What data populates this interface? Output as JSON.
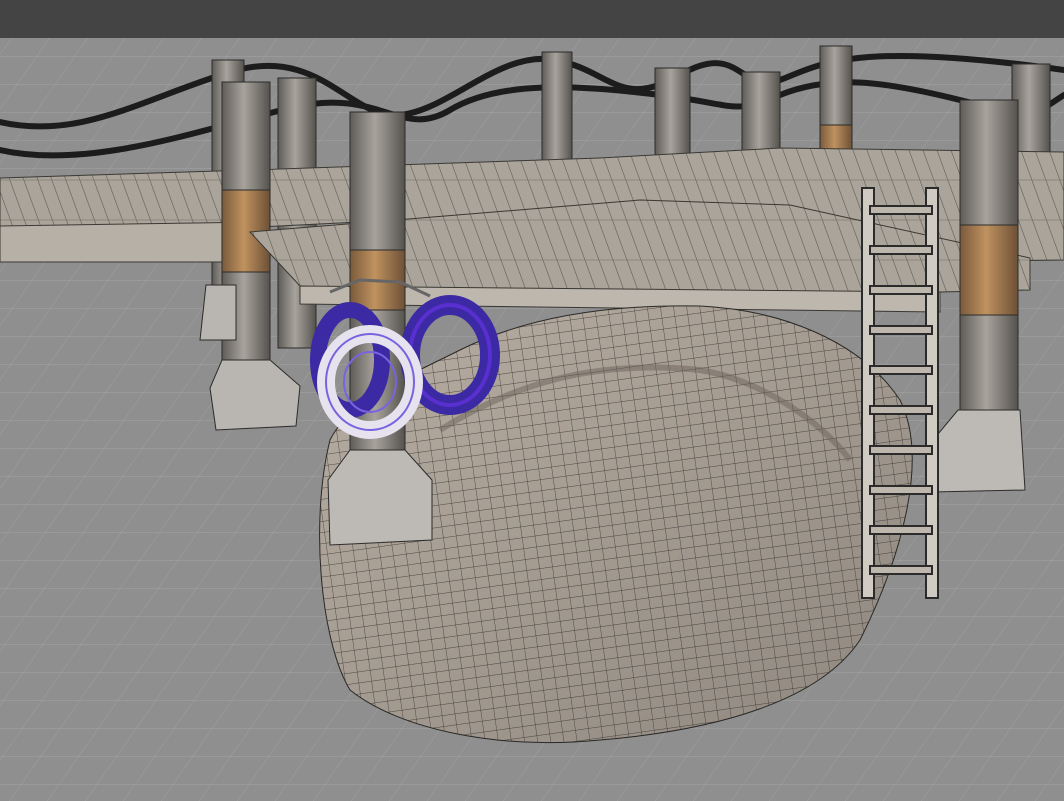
{
  "app": {
    "kind": "3d-modeling-viewport",
    "header_visible": true
  },
  "viewport": {
    "mode": "wireframe-on-shaded",
    "selection_highlight": "#5a2fd0",
    "grid_color": "#9a9a9a",
    "background_color": "#8f8f8f",
    "scene_objects": [
      {
        "name": "dock-platform",
        "icon": "cube-icon"
      },
      {
        "name": "support-pylons",
        "icon": "cylinder-icon"
      },
      {
        "name": "rope-railing",
        "icon": "curve-icon"
      },
      {
        "name": "rock-mesh",
        "icon": "mesh-icon"
      },
      {
        "name": "ladder",
        "icon": "mesh-icon"
      },
      {
        "name": "tire-bumpers",
        "icon": "torus-icon",
        "selected": true
      }
    ]
  }
}
